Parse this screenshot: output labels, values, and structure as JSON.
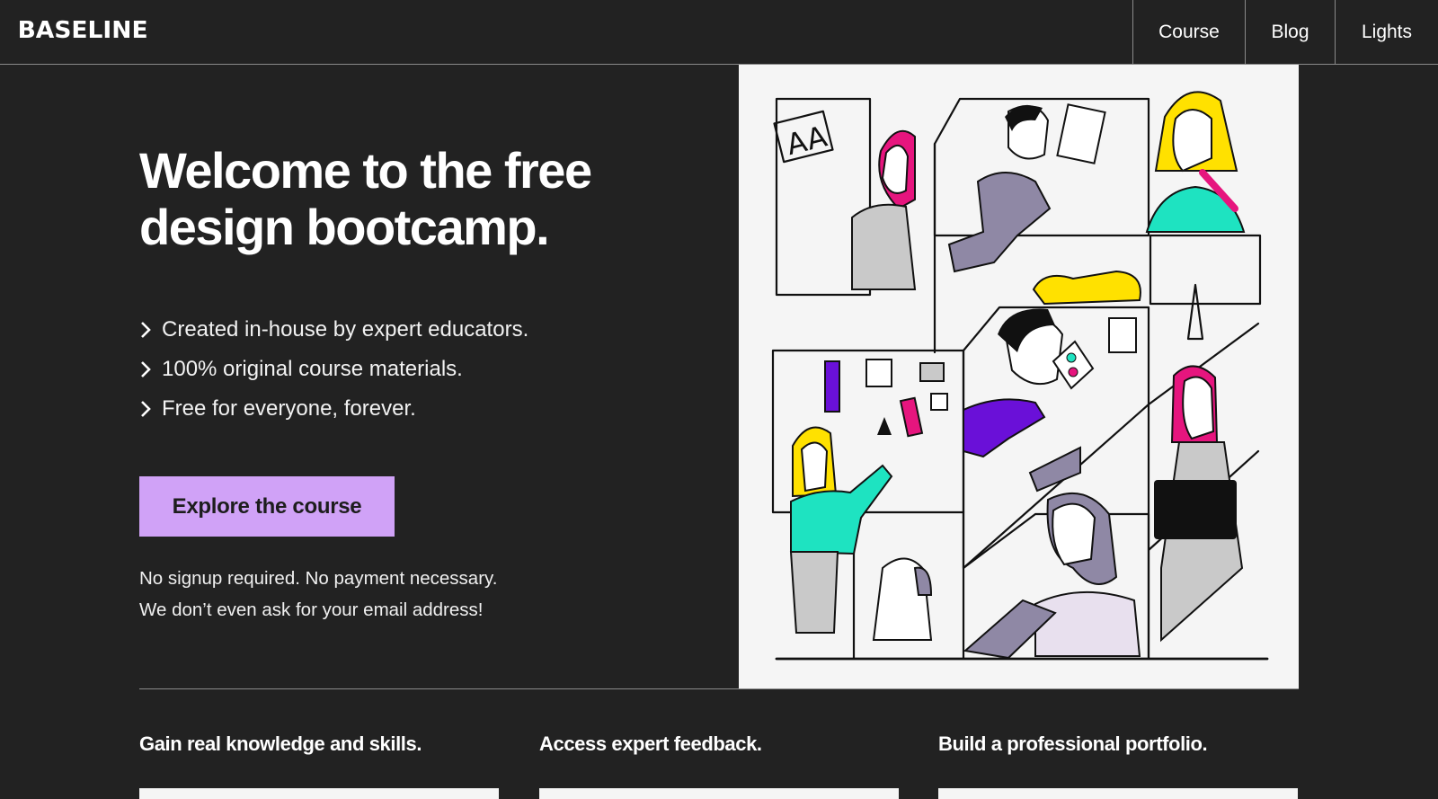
{
  "header": {
    "logo_text": "BASELINE",
    "nav": [
      {
        "label": "Course"
      },
      {
        "label": "Blog"
      },
      {
        "label": "Lights"
      }
    ]
  },
  "hero": {
    "title_line1": "Welcome to the free",
    "title_line2": "design bootcamp.",
    "features": [
      "Created in-house by expert educators.",
      "100% original course materials.",
      "Free for everyone, forever."
    ],
    "cta_label": "Explore the course",
    "note_line1": "No signup required. No payment necessary.",
    "note_line2": "We don’t even ask for your email address!"
  },
  "benefits": [
    {
      "title": "Gain real knowledge and skills."
    },
    {
      "title": "Access expert feedback."
    },
    {
      "title": "Build a professional portfolio."
    }
  ],
  "illustration": {
    "page_label": "AA",
    "colors": {
      "accent": "#d0a2f7",
      "pink": "#e6157e",
      "yellow": "#ffe100",
      "teal": "#1ee3c1",
      "purple": "#6a10d8"
    }
  },
  "icons": {
    "feature_bullet": "chevron-right-icon"
  }
}
